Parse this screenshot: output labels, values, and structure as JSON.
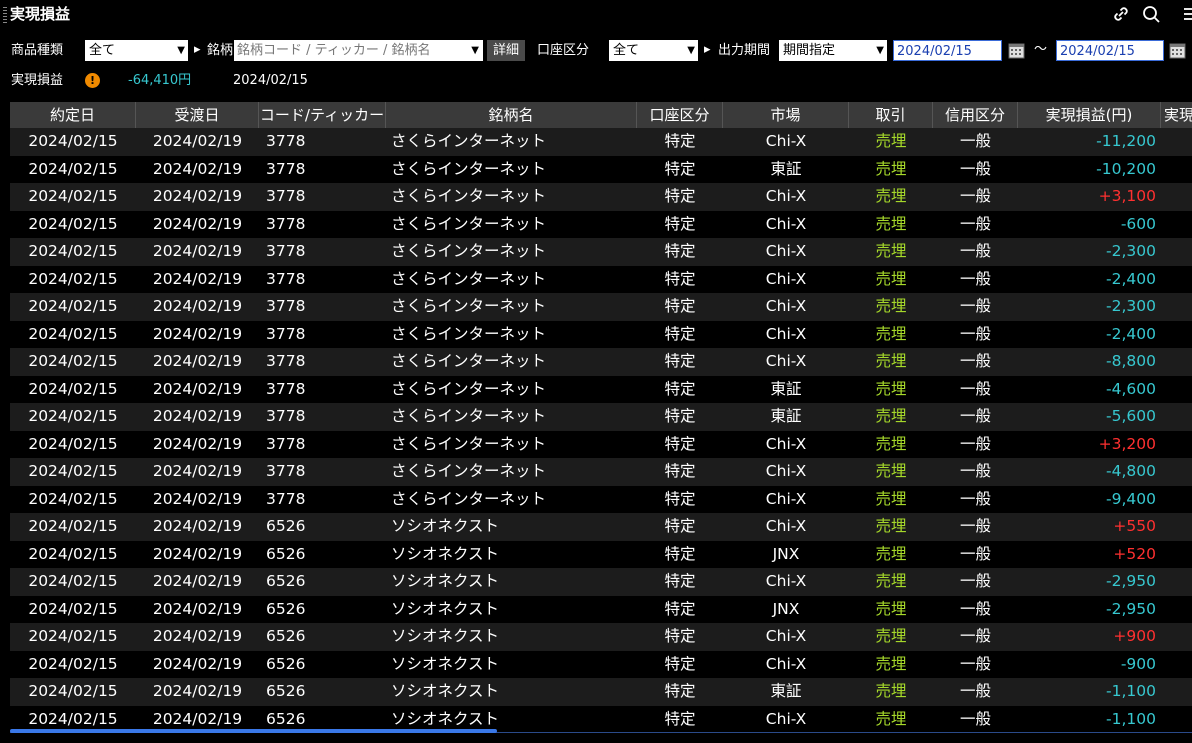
{
  "window": {
    "title": "実現損益"
  },
  "filters": {
    "product_label": "商品種類",
    "product_value": "全て",
    "stock_label": "銘柄",
    "stock_placeholder": "銘柄コード / ティッカー / 銘柄名",
    "detail_button": "詳細",
    "account_label": "口座区分",
    "account_value": "全て",
    "period_label": "出力期間",
    "period_value": "期間指定",
    "date_from": "2024/02/15",
    "tilde": "～",
    "date_to": "2024/02/15"
  },
  "summary": {
    "label": "実現損益",
    "warning_icon": "!",
    "value": "-64,410円",
    "date": "2024/02/15"
  },
  "table": {
    "columns": [
      "約定日",
      "受渡日",
      "コード/ティッカー",
      "銘柄名",
      "口座区分",
      "市場",
      "取引",
      "信用区分",
      "実現損益(円)",
      "実現"
    ],
    "rows": [
      [
        "2024/02/15",
        "2024/02/19",
        "3778",
        "さくらインターネット",
        "特定",
        "Chi-X",
        "売埋",
        "一般",
        "-11,200"
      ],
      [
        "2024/02/15",
        "2024/02/19",
        "3778",
        "さくらインターネット",
        "特定",
        "東証",
        "売埋",
        "一般",
        "-10,200"
      ],
      [
        "2024/02/15",
        "2024/02/19",
        "3778",
        "さくらインターネット",
        "特定",
        "Chi-X",
        "売埋",
        "一般",
        "+3,100"
      ],
      [
        "2024/02/15",
        "2024/02/19",
        "3778",
        "さくらインターネット",
        "特定",
        "Chi-X",
        "売埋",
        "一般",
        "-600"
      ],
      [
        "2024/02/15",
        "2024/02/19",
        "3778",
        "さくらインターネット",
        "特定",
        "Chi-X",
        "売埋",
        "一般",
        "-2,300"
      ],
      [
        "2024/02/15",
        "2024/02/19",
        "3778",
        "さくらインターネット",
        "特定",
        "Chi-X",
        "売埋",
        "一般",
        "-2,400"
      ],
      [
        "2024/02/15",
        "2024/02/19",
        "3778",
        "さくらインターネット",
        "特定",
        "Chi-X",
        "売埋",
        "一般",
        "-2,300"
      ],
      [
        "2024/02/15",
        "2024/02/19",
        "3778",
        "さくらインターネット",
        "特定",
        "Chi-X",
        "売埋",
        "一般",
        "-2,400"
      ],
      [
        "2024/02/15",
        "2024/02/19",
        "3778",
        "さくらインターネット",
        "特定",
        "Chi-X",
        "売埋",
        "一般",
        "-8,800"
      ],
      [
        "2024/02/15",
        "2024/02/19",
        "3778",
        "さくらインターネット",
        "特定",
        "東証",
        "売埋",
        "一般",
        "-4,600"
      ],
      [
        "2024/02/15",
        "2024/02/19",
        "3778",
        "さくらインターネット",
        "特定",
        "東証",
        "売埋",
        "一般",
        "-5,600"
      ],
      [
        "2024/02/15",
        "2024/02/19",
        "3778",
        "さくらインターネット",
        "特定",
        "Chi-X",
        "売埋",
        "一般",
        "+3,200"
      ],
      [
        "2024/02/15",
        "2024/02/19",
        "3778",
        "さくらインターネット",
        "特定",
        "Chi-X",
        "売埋",
        "一般",
        "-4,800"
      ],
      [
        "2024/02/15",
        "2024/02/19",
        "3778",
        "さくらインターネット",
        "特定",
        "Chi-X",
        "売埋",
        "一般",
        "-9,400"
      ],
      [
        "2024/02/15",
        "2024/02/19",
        "6526",
        "ソシオネクスト",
        "特定",
        "Chi-X",
        "売埋",
        "一般",
        "+550"
      ],
      [
        "2024/02/15",
        "2024/02/19",
        "6526",
        "ソシオネクスト",
        "特定",
        "JNX",
        "売埋",
        "一般",
        "+520"
      ],
      [
        "2024/02/15",
        "2024/02/19",
        "6526",
        "ソシオネクスト",
        "特定",
        "Chi-X",
        "売埋",
        "一般",
        "-2,950"
      ],
      [
        "2024/02/15",
        "2024/02/19",
        "6526",
        "ソシオネクスト",
        "特定",
        "JNX",
        "売埋",
        "一般",
        "-2,950"
      ],
      [
        "2024/02/15",
        "2024/02/19",
        "6526",
        "ソシオネクスト",
        "特定",
        "Chi-X",
        "売埋",
        "一般",
        "+900"
      ],
      [
        "2024/02/15",
        "2024/02/19",
        "6526",
        "ソシオネクスト",
        "特定",
        "Chi-X",
        "売埋",
        "一般",
        "-900"
      ],
      [
        "2024/02/15",
        "2024/02/19",
        "6526",
        "ソシオネクスト",
        "特定",
        "東証",
        "売埋",
        "一般",
        "-1,100"
      ],
      [
        "2024/02/15",
        "2024/02/19",
        "6526",
        "ソシオネクスト",
        "特定",
        "Chi-X",
        "売埋",
        "一般",
        "-1,100"
      ]
    ]
  },
  "colors": {
    "positive": "#ff3030",
    "negative": "#37c8d0",
    "sell": "#a6d92a"
  },
  "icons": {
    "link": "link-icon",
    "search": "search-icon",
    "menu": "menu-icon",
    "calendar": "calendar-icon"
  }
}
